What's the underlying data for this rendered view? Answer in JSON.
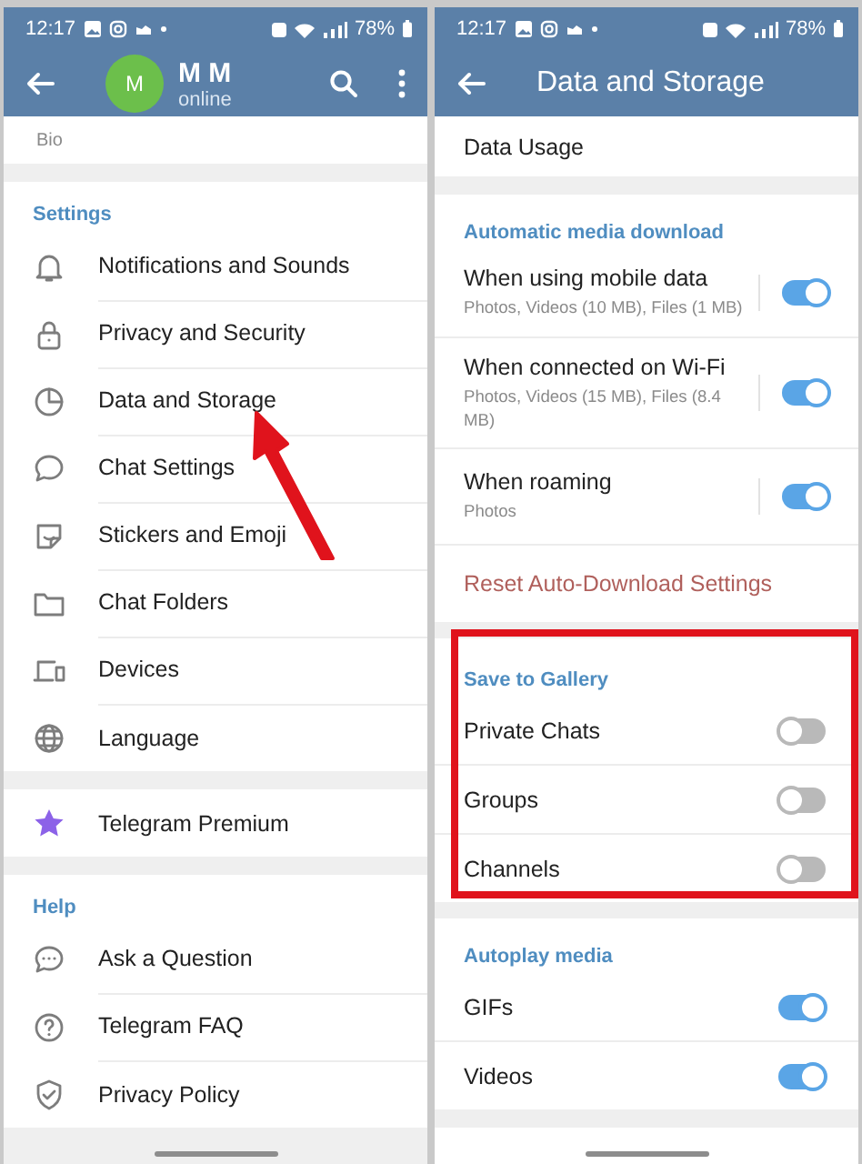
{
  "left": {
    "status_bar": {
      "time": "12:17",
      "battery": "78%"
    },
    "header": {
      "avatar_letter": "M",
      "name": "M M",
      "status": "online"
    },
    "bio_label": "Bio",
    "settings": {
      "title": "Settings",
      "items": [
        {
          "label": "Notifications and Sounds"
        },
        {
          "label": "Privacy and Security"
        },
        {
          "label": "Data and Storage"
        },
        {
          "label": "Chat Settings"
        },
        {
          "label": "Stickers and Emoji"
        },
        {
          "label": "Chat Folders"
        },
        {
          "label": "Devices"
        },
        {
          "label": "Language"
        }
      ]
    },
    "premium": {
      "label": "Telegram Premium"
    },
    "help": {
      "title": "Help",
      "items": [
        {
          "label": "Ask a Question"
        },
        {
          "label": "Telegram FAQ"
        },
        {
          "label": "Privacy Policy"
        }
      ]
    }
  },
  "right": {
    "status_bar": {
      "time": "12:17",
      "battery": "78%"
    },
    "header": {
      "title": "Data and Storage"
    },
    "data_usage": "Data Usage",
    "auto_download": {
      "title": "Automatic media download",
      "items": [
        {
          "label": "When using mobile data",
          "detail": "Photos, Videos (10 MB), Files (1 MB)",
          "on": true
        },
        {
          "label": "When connected on Wi-Fi",
          "detail": "Photos, Videos (15 MB), Files (8.4 MB)",
          "on": true
        },
        {
          "label": "When roaming",
          "detail": "Photos",
          "on": true
        }
      ],
      "reset": "Reset Auto-Download Settings"
    },
    "save_to_gallery": {
      "title": "Save to Gallery",
      "items": [
        {
          "label": "Private Chats",
          "on": false
        },
        {
          "label": "Groups",
          "on": false
        },
        {
          "label": "Channels",
          "on": false
        }
      ]
    },
    "autoplay": {
      "title": "Autoplay media",
      "items": [
        {
          "label": "GIFs",
          "on": true
        },
        {
          "label": "Videos",
          "on": true
        }
      ]
    }
  },
  "annotations": [
    {
      "kind": "arrow"
    },
    {
      "kind": "box"
    }
  ]
}
